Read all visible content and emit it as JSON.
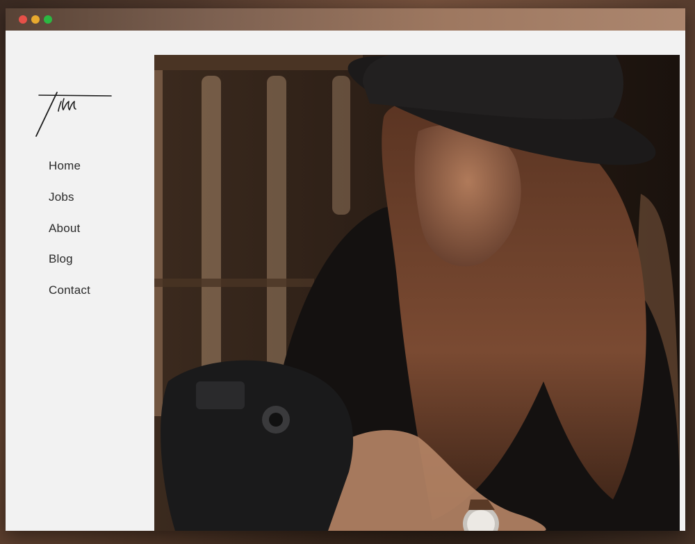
{
  "window": {
    "controls": [
      "close",
      "minimize",
      "maximize"
    ]
  },
  "site": {
    "logo_text": "tim"
  },
  "nav": {
    "items": [
      {
        "label": "Home"
      },
      {
        "label": "Jobs"
      },
      {
        "label": "About"
      },
      {
        "label": "Blog"
      },
      {
        "label": "Contact"
      }
    ]
  },
  "colors": {
    "page_background": "#f2f2f2",
    "nav_text": "#2a2a2a",
    "close": "#f0524a",
    "minimize": "#f3b12f",
    "maximize": "#2ac044"
  }
}
